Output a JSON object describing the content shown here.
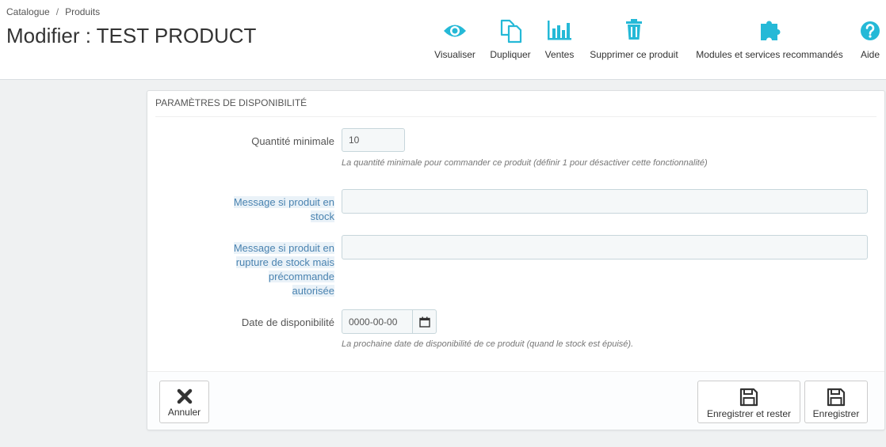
{
  "breadcrumb": {
    "item1": "Catalogue",
    "separator": "/",
    "item2": "Produits"
  },
  "page_title": "Modifier : TEST PRODUCT",
  "toolbar": {
    "view_label": "Visualiser",
    "duplicate_label": "Dupliquer",
    "sales_label": "Ventes",
    "delete_label": "Supprimer ce produit",
    "modules_label": "Modules et services recommandés",
    "help_label": "Aide"
  },
  "colors": {
    "accent": "#25b9d7",
    "hint_bg": "#eaf2f8",
    "hint_text": "#4a83b0"
  },
  "panel": {
    "heading": "PARAMÈTRES DE DISPONIBILITÉ",
    "min_qty": {
      "label": "Quantité minimale",
      "value": "10",
      "help": "La quantité minimale pour commander ce produit (définir 1 pour désactiver cette fonctionnalité)"
    },
    "in_stock_msg": {
      "label_line1": "Message si produit en",
      "label_line2": "stock",
      "value": ""
    },
    "backorder_msg": {
      "label_line1": "Message si produit en",
      "label_line2": "rupture de stock mais",
      "label_line3": "précommande",
      "label_line4": "autorisée",
      "value": ""
    },
    "availability_date": {
      "label": "Date de disponibilité",
      "value": "0000-00-00",
      "help": "La prochaine date de disponibilité de ce produit (quand le stock est épuisé)."
    }
  },
  "footer": {
    "cancel_label": "Annuler",
    "save_stay_label": "Enregistrer et rester",
    "save_label": "Enregistrer"
  }
}
